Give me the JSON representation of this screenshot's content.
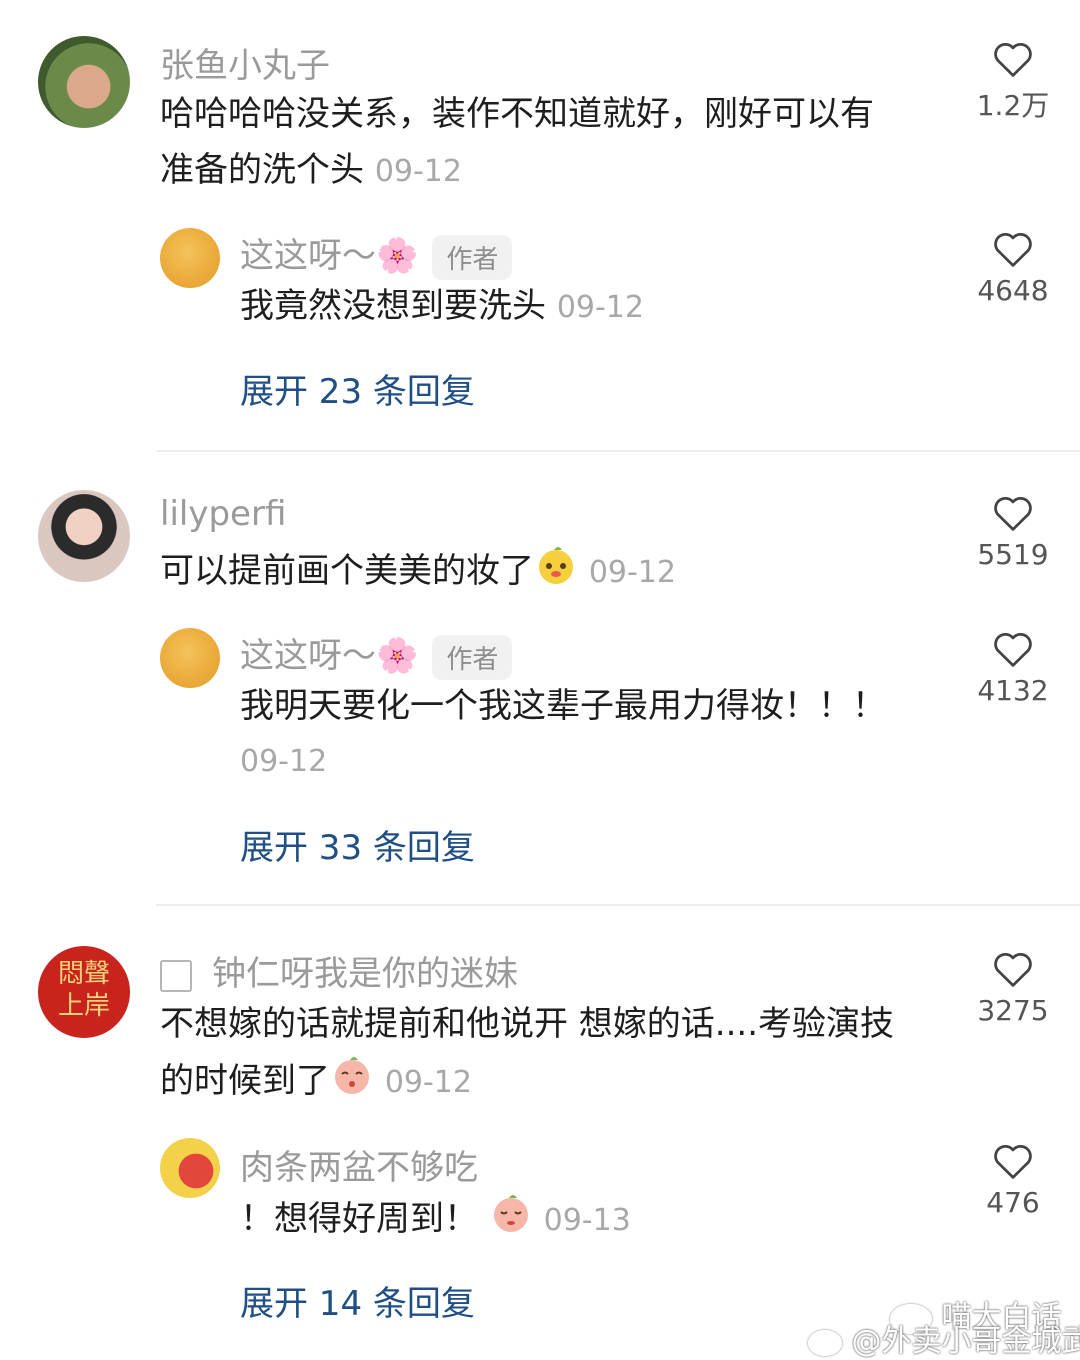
{
  "comments": [
    {
      "username": "张鱼小丸子",
      "content_line1": "哈哈哈哈没关系，装作不知道就好，刚好可以有",
      "content_line2": "准备的洗个头",
      "date": "09-12",
      "likes": "1.2万",
      "reply": {
        "username": "这这呀～🌸",
        "badge": "作者",
        "content": "我竟然没想到要洗头",
        "date": "09-12",
        "likes": "4648"
      },
      "expand": "展开 23 条回复"
    },
    {
      "username": "lilyperfi",
      "content_line1": "可以提前画个美美的妆了",
      "date": "09-12",
      "likes": "5519",
      "reply": {
        "username": "这这呀～🌸",
        "badge": "作者",
        "content": "我明天要化一个我这辈子最用力得妆！！！",
        "date": "09-12",
        "likes": "4132"
      },
      "expand": "展开 33 条回复"
    },
    {
      "username": "钟仁呀我是你的迷妹",
      "avatar_text": "悶聲上岸",
      "content_line1": "不想嫁的话就提前和他说开 想嫁的话....考验演技",
      "content_line2": "的时候到了",
      "date": "09-12",
      "likes": "3275",
      "reply": {
        "username": "肉条两盆不够吃",
        "content": "！想得好周到！",
        "date": "09-13",
        "likes": "476"
      },
      "expand": "展开 14 条回复"
    }
  ],
  "watermark": {
    "line1": "喵大白话",
    "line2": "@外卖小哥金城武"
  },
  "colors": {
    "link": "#1f4f84",
    "muted": "#9a9a9a",
    "divider": "#eeeeee"
  }
}
